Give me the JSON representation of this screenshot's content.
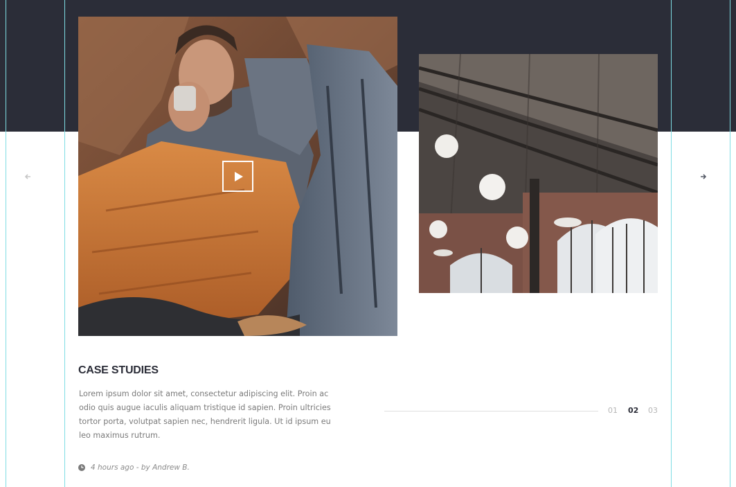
{
  "slider": {
    "prev_icon": "arrow-left-icon",
    "next_icon": "arrow-right-icon"
  },
  "featured": {
    "main_image": "camper-sleeping-bag-photo",
    "side_image": "industrial-loft-photo",
    "play_icon": "play-icon"
  },
  "article": {
    "title": "CASE STUDIES",
    "body": "Lorem ipsum dolor sit amet, consectetur adipiscing elit. Proin ac odio quis augue iaculis aliquam tristique id sapien. Proin ultricies tortor porta, volutpat sapien nec, hendrerit ligula. Ut id ipsum eu leo maximus rutrum.",
    "meta_icon": "clock-icon",
    "meta": "4 hours ago - by Andrew B."
  },
  "pagination": {
    "pages": [
      "01",
      "02",
      "03"
    ],
    "active": "02"
  },
  "colors": {
    "dark": "#2b2d38",
    "guide": "#7fdde3",
    "body_text": "#7a7a7a"
  }
}
